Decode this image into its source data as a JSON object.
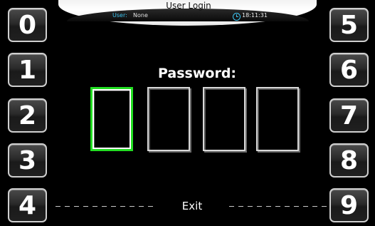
{
  "header": {
    "title": "User Login",
    "user_label": "User:",
    "user_value": "None",
    "time": "18:11:31",
    "clock_icon": "clock-icon"
  },
  "keypad": {
    "left": [
      "0",
      "1",
      "2",
      "3",
      "4"
    ],
    "right": [
      "5",
      "6",
      "7",
      "8",
      "9"
    ]
  },
  "password": {
    "label": "Password:",
    "digits_entered": 0,
    "digit_count": 4
  },
  "exit_label": "Exit",
  "colors": {
    "accent_cyan": "#3cc3f0",
    "active_box": "#22dd22",
    "background": "#000000"
  }
}
